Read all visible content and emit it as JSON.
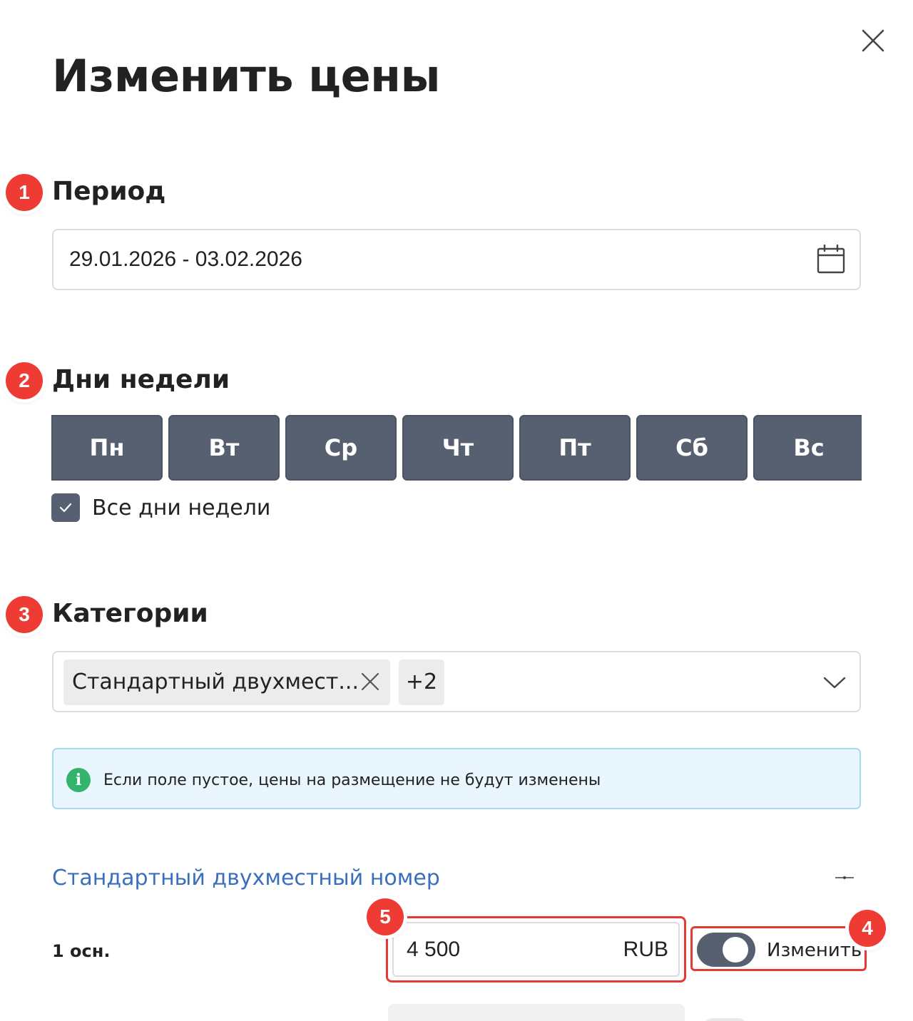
{
  "dialog": {
    "title": "Изменить цены",
    "close_icon": "close-icon"
  },
  "annotations": {
    "badge1": "1",
    "badge2": "2",
    "badge3": "3",
    "badge4": "4",
    "badge5": "5",
    "badge_color": "#ee3b34"
  },
  "period": {
    "title": "Период",
    "value": "29.01.2026 - 03.02.2026",
    "icon": "calendar-icon"
  },
  "weekdays": {
    "title": "Дни недели",
    "days": [
      "Пн",
      "Вт",
      "Ср",
      "Чт",
      "Пт",
      "Сб",
      "Вс"
    ],
    "all_days_label": "Все дни недели",
    "all_days_checked": true,
    "active_color": "#566070"
  },
  "categories": {
    "title": "Категории",
    "selected_chip": "Стандартный двухмест...",
    "more_count": "+2",
    "chip_remove_icon": "close-icon",
    "dropdown_icon": "chevron-down-icon"
  },
  "info": {
    "message": "Если поле пустое, цены на размещение не будут изменены",
    "icon": "info-icon",
    "icon_symbol": "i"
  },
  "room": {
    "name": "Стандартный двухместный номер",
    "collapse_icon": "collapse-icon",
    "rows": [
      {
        "label": "1 осн.",
        "price": "4 500",
        "currency": "RUB",
        "toggle_label": "Изменить",
        "toggle_on": true
      }
    ]
  },
  "colors": {
    "link": "#3a6fc0",
    "highlight": "#e53935",
    "info_bg": "#e9f6fd"
  }
}
